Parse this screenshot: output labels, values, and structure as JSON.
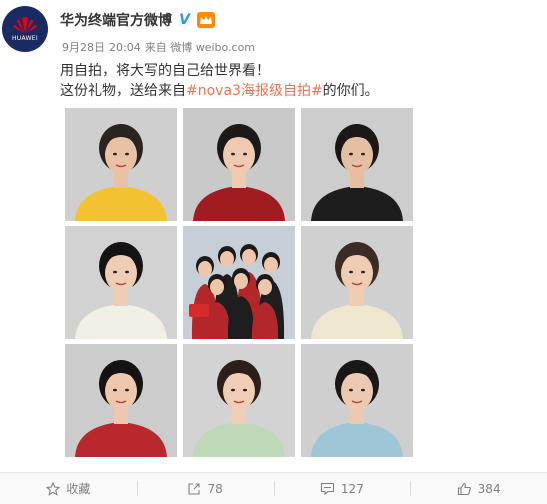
{
  "account": {
    "name": "华为终端官方微博",
    "avatar_text": "HUAWEI",
    "verified_icon": "V",
    "member_badge": "vip"
  },
  "meta": {
    "date": "9月28日",
    "time": "20:04",
    "source": "来自 微博 weibo.com"
  },
  "post": {
    "line1": "用自拍，将大写的自己给世界看！",
    "line2_prefix": "这份礼物，送给来自",
    "topic": "#nova3海报级自拍#",
    "line2_suffix": "的你们。"
  },
  "photos": [
    {
      "bg": "#cfcfcf",
      "shirt": "#f2c230",
      "hair": "#2a2420",
      "skin": "#e9c2a6"
    },
    {
      "bg": "#c9c9c9",
      "shirt": "#a01c20",
      "hair": "#1c1a19",
      "skin": "#efc9b0"
    },
    {
      "bg": "#cdcdcd",
      "shirt": "#1d1d1d",
      "hair": "#1a1716",
      "skin": "#e6bfa3"
    },
    {
      "bg": "#d2d2d2",
      "shirt": "#f2efe6",
      "hair": "#151313",
      "skin": "#efccb4"
    },
    {
      "bg": "#c6cfd8",
      "shirt": "#b3272a",
      "hair": "#1c1918",
      "skin": "#eec6ab"
    },
    {
      "bg": "#d0d0d0",
      "shirt": "#efe6cf",
      "hair": "#3a2b24",
      "skin": "#f0ccb3"
    },
    {
      "bg": "#cccccc",
      "shirt": "#b8282c",
      "hair": "#141212",
      "skin": "#efc7ad"
    },
    {
      "bg": "#d3d3d3",
      "shirt": "#bfd9b8",
      "hair": "#2b1f1a",
      "skin": "#f0cdb5"
    },
    {
      "bg": "#cfcfcf",
      "shirt": "#9fc6d6",
      "hair": "#1b1716",
      "skin": "#eec9b1"
    }
  ],
  "actions": {
    "favorite": "收藏",
    "forward": "78",
    "comment": "127",
    "like": "384"
  }
}
